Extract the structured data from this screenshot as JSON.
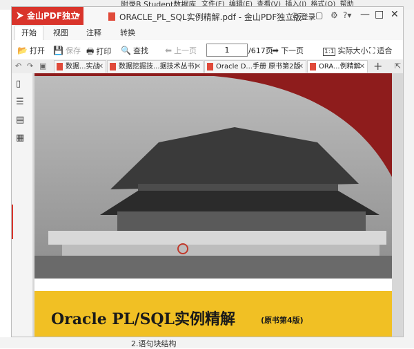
{
  "background_app": {
    "title_fragment": "附录B Student数据库",
    "menus": [
      "文件(F)",
      "编辑(E)",
      "查看(V)",
      "插入(I)",
      "格式(O)",
      "帮助"
    ],
    "bottom_text": "2.语句块结构"
  },
  "window": {
    "app_name": "金山PDF独立版",
    "doc_title": "ORACLE_PL_SQL实例精解.pdf - 金山PDF独立版",
    "login_label": "登录",
    "accent": "#d9342b"
  },
  "ribbon_tabs": [
    {
      "label": "开始"
    },
    {
      "label": "视图"
    },
    {
      "label": "注释"
    },
    {
      "label": "转换"
    }
  ],
  "toolbar": {
    "open": "打开",
    "save": "保存",
    "print": "打印",
    "find": "查找",
    "prev": "上一页",
    "page_value": "1",
    "page_total": "/617页",
    "next": "下一页",
    "actual_size": "实际大小",
    "fit": "适合"
  },
  "doc_tabs": [
    {
      "label": "数据...实战"
    },
    {
      "label": "数据挖掘技...据技术丛书)"
    },
    {
      "label": "Oracle D...手册 原书第2版"
    },
    {
      "label": "ORA...例精解"
    }
  ],
  "book": {
    "title": "Oracle PL/SQL实例精解",
    "subtitle": "(原书第4版)"
  }
}
